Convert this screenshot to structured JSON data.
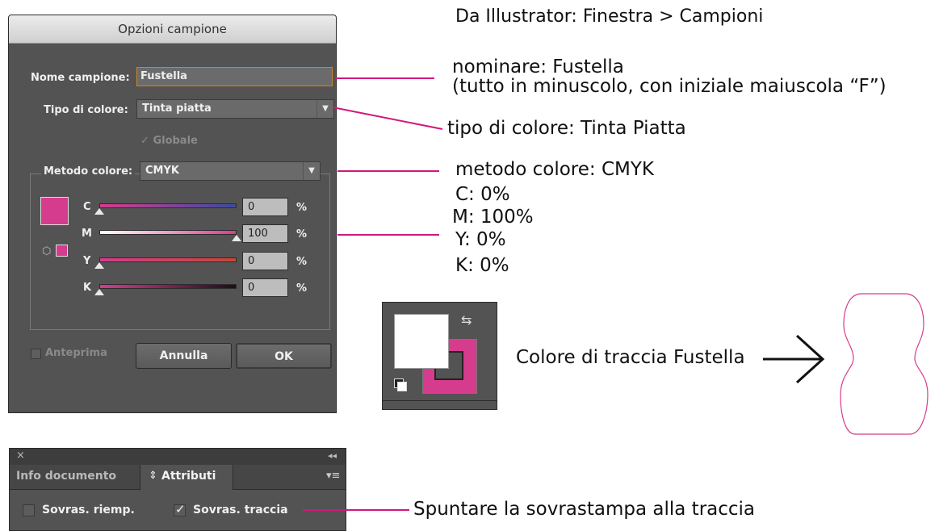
{
  "dialog": {
    "title": "Opzioni campione",
    "name_label": "Nome campione:",
    "name_value": "Fustella",
    "color_type_label": "Tipo di colore:",
    "color_type_value": "Tinta piatta",
    "global_label": "Globale",
    "global_checked": true,
    "mode_label": "Metodo colore:",
    "mode_value": "CMYK",
    "swatch_color": "#d63c8d",
    "channels": [
      {
        "letter": "C",
        "value": "0",
        "unit": "%",
        "level": 0.0
      },
      {
        "letter": "M",
        "value": "100",
        "unit": "%",
        "level": 1.0
      },
      {
        "letter": "Y",
        "value": "0",
        "unit": "%",
        "level": 0.0
      },
      {
        "letter": "K",
        "value": "0",
        "unit": "%",
        "level": 0.0
      }
    ],
    "preview_label": "Anteprima",
    "cancel_label": "Annulla",
    "ok_label": "OK"
  },
  "annotations": {
    "source": "Da Illustrator: Finestra > Campioni",
    "name_line1": "nominare:  Fustella",
    "name_line2": "(tutto in minuscolo, con iniziale maiuscola “F”)",
    "color_type": "tipo di colore: Tinta Piatta",
    "mode": "metodo colore: CMYK",
    "c": "C: 0%",
    "m": "M:  100%",
    "y": "Y: 0%",
    "k": "K: 0%",
    "stroke": "Colore di traccia Fustella",
    "overprint": "Spuntare la sovrastampa alla traccia"
  },
  "attributes_panel": {
    "tab_info": "Info documento",
    "tab_attributes": "Attributi",
    "fill_overprint_label": "Sovras. riemp.",
    "fill_overprint_checked": false,
    "stroke_overprint_label": "Sovras. traccia",
    "stroke_overprint_checked": true
  },
  "colors": {
    "accent_pink": "#d1187e",
    "stroke_pink": "#d63c8d",
    "panel_gray": "#535353"
  }
}
